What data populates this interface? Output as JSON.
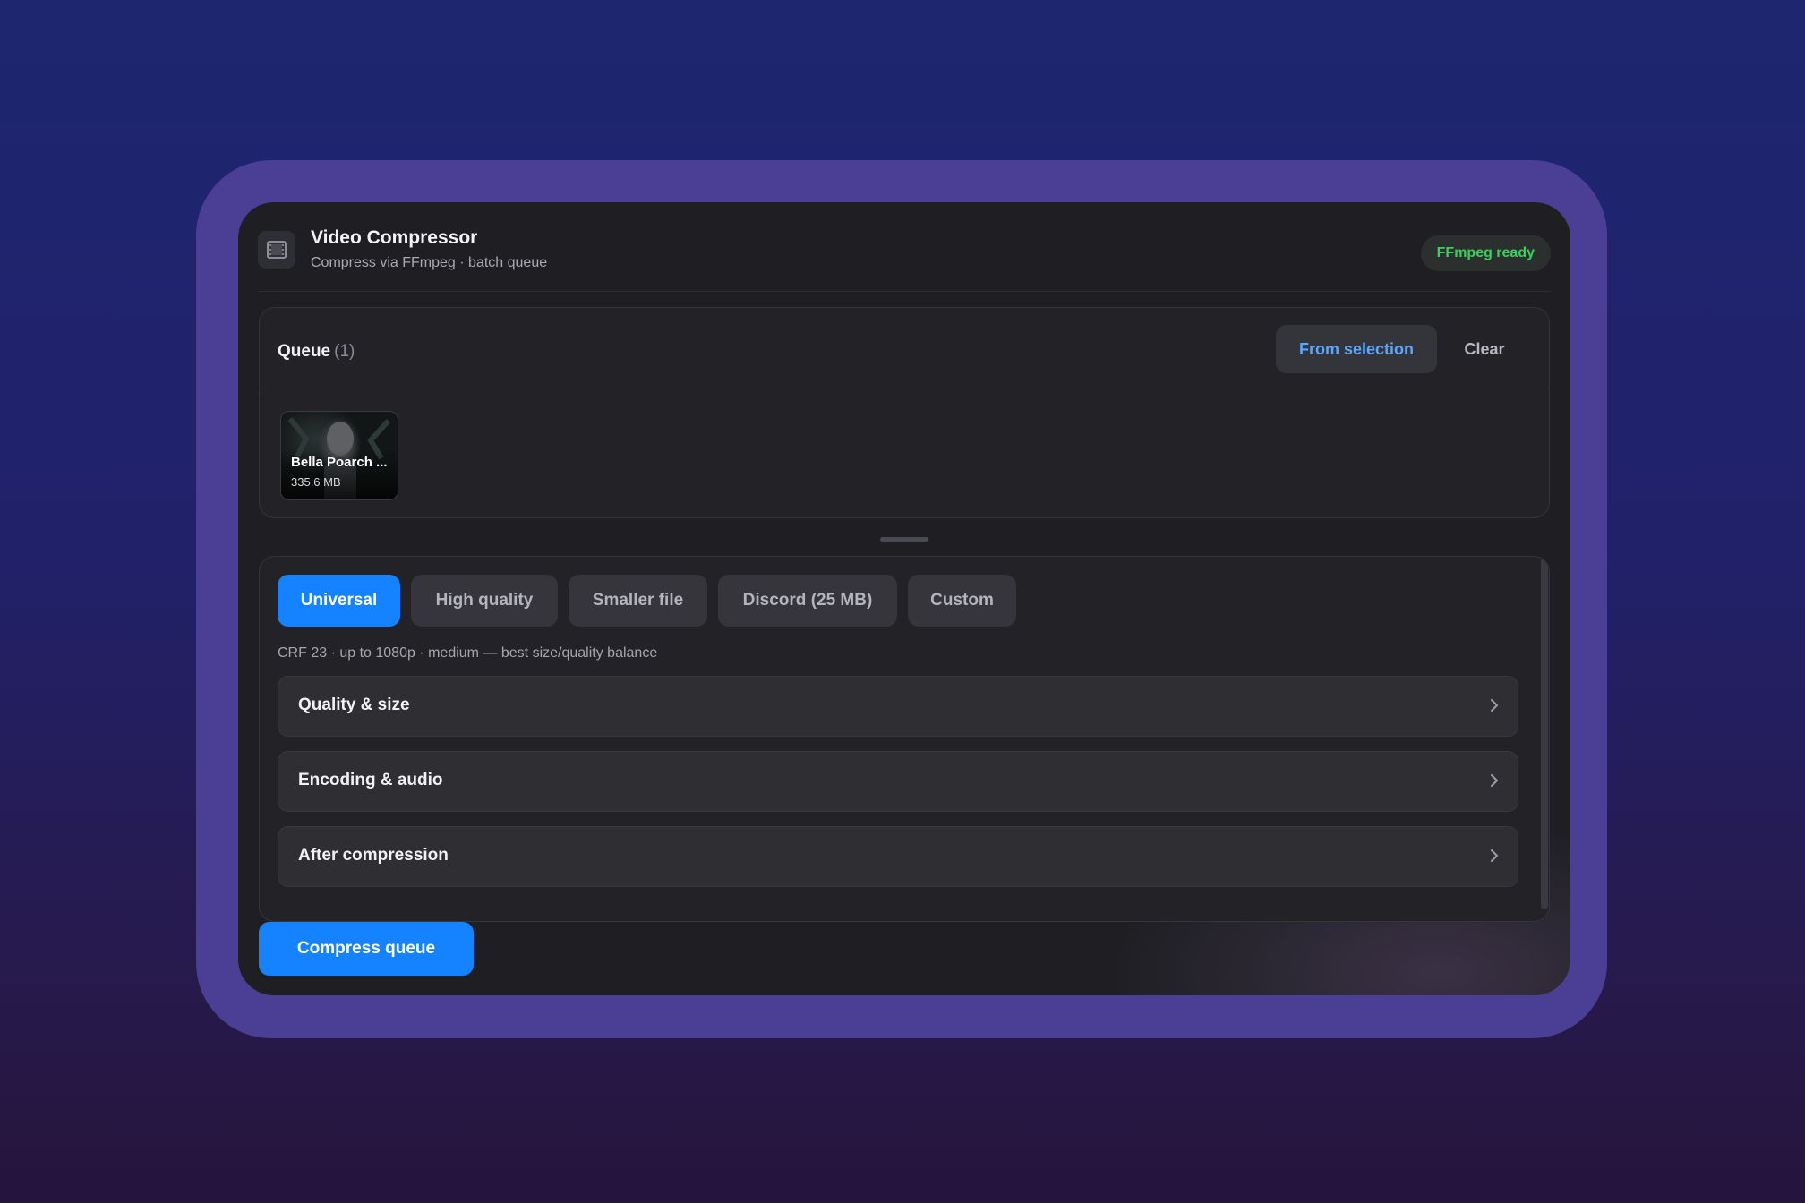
{
  "app": {
    "title": "Video Compressor",
    "subtitle": "Compress via FFmpeg · batch queue",
    "icon": "film-icon",
    "status": "FFmpeg ready",
    "status_color": "#3ad05d"
  },
  "queue": {
    "title": "Queue",
    "count": "(1)",
    "from_selection_label": "From selection",
    "clear_label": "Clear",
    "items": [
      {
        "name": "Bella Poarch ...",
        "size": "335.6 MB"
      }
    ]
  },
  "presets": {
    "items": [
      {
        "label": "Universal",
        "active": true
      },
      {
        "label": "High quality",
        "active": false
      },
      {
        "label": "Smaller file",
        "active": false
      },
      {
        "label": "Discord (25 MB)",
        "active": false
      },
      {
        "label": "Custom",
        "active": false
      }
    ],
    "description": "CRF 23 · up to 1080p · medium — best size/quality balance"
  },
  "sections": [
    {
      "label": "Quality & size"
    },
    {
      "label": "Encoding & audio"
    },
    {
      "label": "After compression"
    }
  ],
  "actions": {
    "compress_label": "Compress queue"
  },
  "colors": {
    "accent": "#1583ff",
    "link": "#5aa7ff",
    "ready": "#3ad05d"
  }
}
